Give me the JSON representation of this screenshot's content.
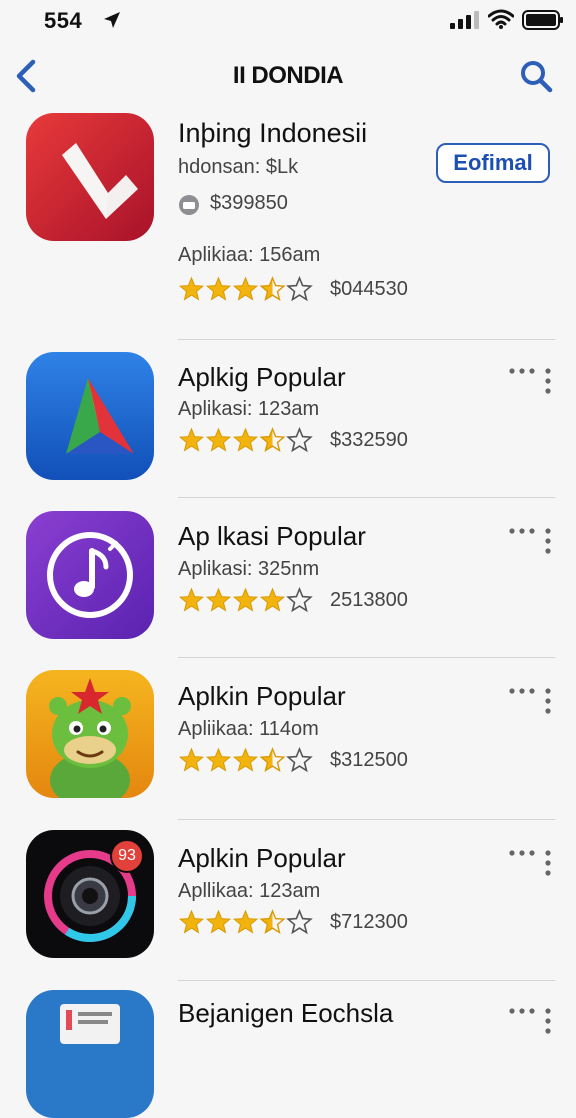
{
  "status_bar": {
    "time": "554"
  },
  "nav": {
    "title": "II DONDIA"
  },
  "featured": {
    "title": "Inþing Indonesii",
    "subtitle": "hdonsan: $Lk",
    "price": "$399850",
    "apps_label": "Aplikiaa: 156am",
    "rating_value": "$044530",
    "rating": 3.5,
    "get_button": "Eofimal"
  },
  "list": [
    {
      "title": "Aplkig Popular",
      "subtitle": "Aplikasi: 123am",
      "rating_value": "$332590",
      "rating": 3.5,
      "icon": "triangle-logo-icon"
    },
    {
      "title": "Ap lkasi Popular",
      "subtitle": "Aplikasi: 325nm",
      "rating_value": "2513800",
      "rating": 4,
      "icon": "music-note-icon"
    },
    {
      "title": "Aplkin Popular",
      "subtitle": "Apliikaa: 114om",
      "rating_value": "$312500",
      "rating": 3.5,
      "icon": "dinosaur-character-icon"
    },
    {
      "title": "Aplkin Popular",
      "subtitle": "Apllikaa: 123am",
      "rating_value": "$712300",
      "rating": 3.5,
      "icon": "camera-lens-icon",
      "badge": "93"
    },
    {
      "title": "Bejanigen Eochsla",
      "icon": "document-icon"
    }
  ],
  "colors": {
    "accent": "#2e5fb8",
    "star": "#f2b30f"
  }
}
